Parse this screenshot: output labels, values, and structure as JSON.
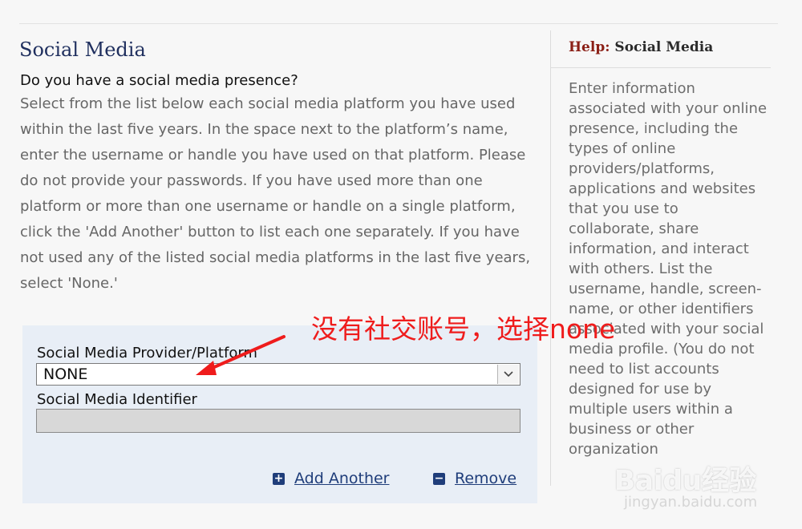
{
  "section": {
    "title": "Social Media",
    "question": "Do you have a social media presence?",
    "instructions": "Select from the list below each social media platform you have used within the last five years. In the space next to the platform’s name, enter the username or handle you have used on that platform. Please do not provide your passwords. If you have used more than one platform or more than one username or handle on a single platform, click the 'Add Another' button to list each one separately. If you have not used any of the listed social media platforms in the last five years, select 'None.'"
  },
  "form": {
    "platform_label": "Social Media Provider/Platform",
    "platform_value": "NONE",
    "identifier_label": "Social Media Identifier",
    "identifier_value": "",
    "add_label": "Add Another",
    "remove_label": "Remove"
  },
  "help": {
    "prefix": "Help:",
    "topic": "Social Media",
    "text": "Enter information associated with your online presence, including the types of online providers/platforms, applications and websites that you use to collaborate, share information, and interact with others. List the username, handle, screen-name, or other identifiers associated with your social media profile. (You do not need to list accounts designed for use by multiple users within a business or other organization"
  },
  "annotation": {
    "text": "没有社交账号，选择none",
    "color": "#ef1c1c"
  },
  "watermark": {
    "logo": "Baidu经验",
    "url": "jingyan.baidu.com"
  },
  "colors": {
    "title_navy": "#1f2f5e",
    "link_blue": "#1f3d7a",
    "help_prefix": "#8b1f16",
    "form_bg": "#e8eef6"
  }
}
